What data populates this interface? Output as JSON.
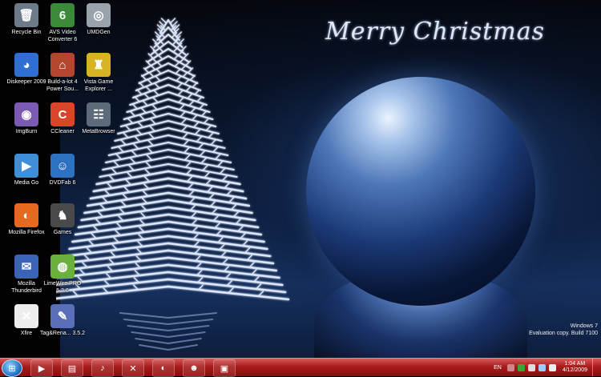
{
  "wallpaper": {
    "greeting": "Merry Christmas"
  },
  "icons": [
    {
      "label": "Recycle Bin",
      "icon": "recycle-bin-icon",
      "glyph": "🗑",
      "color": "#6c7a8a"
    },
    {
      "label": "AVS Video Converter 6",
      "icon": "avs-video-converter-icon",
      "glyph": "6",
      "color": "#3b8a3a"
    },
    {
      "label": "UMDGen",
      "icon": "umdgen-icon",
      "glyph": "◎",
      "color": "#9aa3ab"
    },
    {
      "label": "Diskeeper 2009",
      "icon": "diskeeper-icon",
      "glyph": "◕",
      "color": "#2f6fd1"
    },
    {
      "label": "Build-a-lot 4 Power Sou...",
      "icon": "build-a-lot-icon",
      "glyph": "⌂",
      "color": "#b4452f"
    },
    {
      "label": "Vista Game Explorer ...",
      "icon": "vista-game-explorer-icon",
      "glyph": "♜",
      "color": "#d8b323"
    },
    {
      "label": "ImgBurn",
      "icon": "imgburn-icon",
      "glyph": "◉",
      "color": "#7b5ab4"
    },
    {
      "label": "CCleaner",
      "icon": "ccleaner-icon",
      "glyph": "C",
      "color": "#d8452a"
    },
    {
      "label": "MetaBrowser",
      "icon": "metabrowser-icon",
      "glyph": "☷",
      "color": "#5d6a7a"
    },
    {
      "label": "Media Go",
      "icon": "media-go-icon",
      "glyph": "▶",
      "color": "#3f8fd8"
    },
    {
      "label": "DVDFab 6",
      "icon": "dvdfab-icon",
      "glyph": "☺",
      "color": "#2d73c2"
    },
    {
      "label": "Mozilla Firefox",
      "icon": "firefox-icon",
      "glyph": "◐",
      "color": "#e56a1f"
    },
    {
      "label": "Games",
      "icon": "games-icon",
      "glyph": "♞",
      "color": "#4a4a4a"
    },
    {
      "label": "Mozilla Thunderbird",
      "icon": "thunderbird-icon",
      "glyph": "✉",
      "color": "#3a64b8"
    },
    {
      "label": "LimeWire PRO 5.3.6",
      "icon": "limewire-icon",
      "glyph": "◍",
      "color": "#6bb03c"
    },
    {
      "label": "Xfire",
      "icon": "xfire-icon",
      "glyph": "✕",
      "color": "#eeeeee"
    },
    {
      "label": "Tag&Rena... 3.5.2",
      "icon": "tag-and-rename-icon",
      "glyph": "✎",
      "color": "#5a6fb8"
    }
  ],
  "watermark": {
    "line1": "Windows 7",
    "line2": "Evaluation copy. Build 7100"
  },
  "taskbar": {
    "pinned": [
      {
        "icon": "windows-media-player-icon",
        "glyph": "▶"
      },
      {
        "icon": "windows-explorer-icon",
        "glyph": "▤"
      },
      {
        "icon": "media-go-taskbar-icon",
        "glyph": "♪"
      },
      {
        "icon": "xfire-taskbar-icon",
        "glyph": "✕"
      },
      {
        "icon": "firefox-taskbar-icon",
        "glyph": "◐"
      },
      {
        "icon": "messenger-icon",
        "glyph": "☻"
      },
      {
        "icon": "remote-desktop-icon",
        "glyph": "▣"
      }
    ],
    "tray": {
      "language": "EN",
      "time": "1:04 AM",
      "date": "4/12/2009"
    }
  }
}
